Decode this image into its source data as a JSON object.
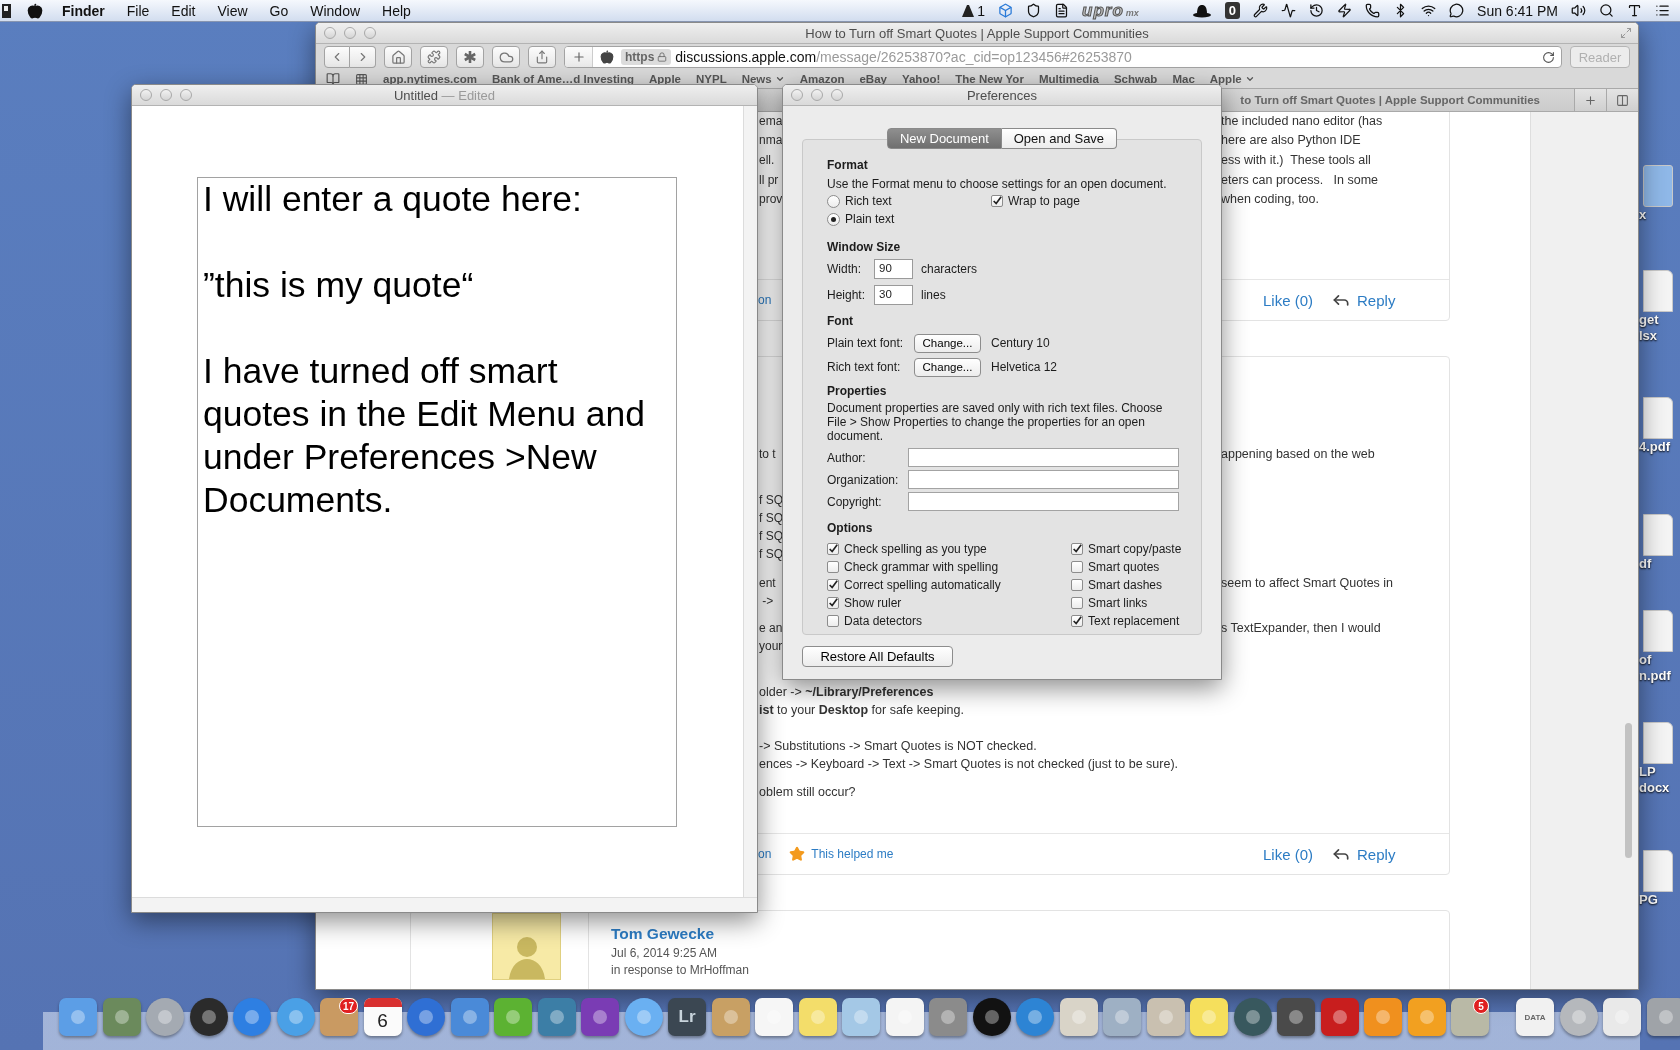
{
  "menu_bar": {
    "app_name": "Finder",
    "menus": [
      "File",
      "Edit",
      "View",
      "Go",
      "Window",
      "Help"
    ],
    "status": {
      "count": "1",
      "logo": "upro",
      "logo_suffix": "mx",
      "box_digit": "0",
      "clock": "Sun 6:41 PM"
    }
  },
  "browser": {
    "title": "How to Turn off Smart Quotes | Apple Support Communities",
    "address": {
      "scheme": "https",
      "host": "discussions.apple.com",
      "path": "/message/26253870?ac_cid=op123456#26253870"
    },
    "reader_button": {
      "label": "Reader",
      "disabled": true
    },
    "bookmarks": [
      {
        "label": "app.nytimes.com",
        "menu": false
      },
      {
        "label": "Bank of Ame…d Investing",
        "menu": false
      },
      {
        "label": "Apple",
        "menu": false
      },
      {
        "label": "NYPL",
        "menu": false
      },
      {
        "label": "News",
        "menu": true
      },
      {
        "label": "Amazon",
        "menu": false
      },
      {
        "label": "eBay",
        "menu": false
      },
      {
        "label": "Yahoo!",
        "menu": false
      },
      {
        "label": "The New Yor",
        "menu": false
      },
      {
        "label": "Multimedia",
        "menu": false
      },
      {
        "label": "Schwab",
        "menu": false
      },
      {
        "label": "Mac",
        "menu": false
      },
      {
        "label": "Apple",
        "menu": true
      }
    ],
    "tab": {
      "label": "to Turn off Smart Quotes | Apple Support Communities"
    },
    "posts": [
      {
        "kind": "fragment",
        "paragraphs": [
          [
            {
              "left": "ema",
              "right": "the included nano editor (has"
            },
            {
              "left": "nma",
              "right": "here are also Python IDE"
            },
            {
              "left": "ell.",
              "right": "ess with it.)  These tools all"
            },
            {
              "left": "ll pr",
              "right": "eters can process.   In some"
            },
            {
              "left": "prov",
              "right": "when coding, too."
            }
          ]
        ],
        "footer": {
          "link": "on",
          "like": "Like (0)",
          "reply": "Reply"
        }
      },
      {
        "kind": "fragment",
        "paragraphs": [
          [
            {
              "left": "to t",
              "right": "appening based on the web"
            }
          ],
          [
            {
              "left": "f SQ"
            },
            {
              "left": "f SQ"
            },
            {
              "left": "f SQ"
            },
            {
              "left": "f SQ"
            }
          ],
          [
            {
              "left": "ent",
              "right": "seem to affect Smart Quotes in"
            },
            {
              "left": " ->"
            }
          ],
          [
            {
              "left": "e an",
              "right": "s TextExpander, then I would"
            },
            {
              "left": "your"
            }
          ],
          [
            {
              "text": "older -> **~/Library/Preferences**"
            },
            {
              "text": "**ist** to your **Desktop** for safe keeping."
            }
          ],
          [
            {
              "text": "-> Substitutions -> Smart Quotes is NOT checked."
            },
            {
              "text": "ences -> Keyboard -> Text -> Smart Quotes is not checked (just to be sure)."
            }
          ],
          [
            {
              "text": "oblem still occur?"
            }
          ]
        ],
        "footer": {
          "link": "on",
          "helped": "This helped me",
          "like": "Like (0)",
          "reply": "Reply"
        }
      },
      {
        "kind": "author",
        "name": "Tom Gewecke",
        "date": "Jul 6, 2014 9:25 AM",
        "in_reply": "in response to MrHoffman"
      }
    ]
  },
  "textedit": {
    "title": "Untitled",
    "edited": "— Edited",
    "paragraphs": [
      "I will enter a quote here:",
      "”this is my quote“",
      "I have turned off smart quotes in the Edit Menu and under Preferences >New Documents."
    ]
  },
  "preferences": {
    "title": "Preferences",
    "tabs": [
      {
        "label": "New Document",
        "selected": true
      },
      {
        "label": "Open and Save",
        "selected": false
      }
    ],
    "format": {
      "heading": "Format",
      "description": "Use the Format menu to choose settings for an open document.",
      "radios": [
        {
          "label": "Rich text",
          "selected": false
        },
        {
          "label": "Plain text",
          "selected": true
        }
      ],
      "wrap": {
        "label": "Wrap to page",
        "checked": true
      }
    },
    "window_size": {
      "heading": "Window Size",
      "fields": [
        {
          "label": "Width:",
          "value": "90",
          "unit": "characters"
        },
        {
          "label": "Height:",
          "value": "30",
          "unit": "lines"
        }
      ]
    },
    "font": {
      "heading": "Font",
      "rows": [
        {
          "label": "Plain text font:",
          "button": "Change...",
          "value": "Century 10"
        },
        {
          "label": "Rich text font:",
          "button": "Change...",
          "value": "Helvetica 12"
        }
      ]
    },
    "properties": {
      "heading": "Properties",
      "description": "Document properties are saved only with rich text files. Choose File > Show Properties to change the properties for an open document.",
      "fields": [
        {
          "label": "Author:"
        },
        {
          "label": "Organization:"
        },
        {
          "label": "Copyright:"
        }
      ]
    },
    "options": {
      "heading": "Options",
      "left": [
        {
          "label": "Check spelling as you type",
          "checked": true
        },
        {
          "label": "Check grammar with spelling",
          "checked": false
        },
        {
          "label": "Correct spelling automatically",
          "checked": true
        },
        {
          "label": "Show ruler",
          "checked": true
        },
        {
          "label": "Data detectors",
          "checked": false
        }
      ],
      "right": [
        {
          "label": "Smart copy/paste",
          "checked": true
        },
        {
          "label": "Smart quotes",
          "checked": false
        },
        {
          "label": "Smart dashes",
          "checked": false
        },
        {
          "label": "Smart links",
          "checked": false
        },
        {
          "label": "Text replacement",
          "checked": true
        }
      ]
    },
    "restore_button": "Restore All Defaults"
  },
  "desktop_icons": [
    {
      "lines": [
        "x"
      ]
    },
    {
      "lines": [
        "get",
        "lsx"
      ]
    },
    {
      "lines": [
        "4.pdf"
      ]
    },
    {
      "lines": [
        "df"
      ]
    },
    {
      "lines": [
        "of",
        "n.pdf"
      ]
    },
    {
      "lines": [
        "LP",
        "docx"
      ]
    },
    {
      "lines": [
        "PG"
      ]
    }
  ],
  "dock": {
    "badges": [
      "17",
      "5"
    ],
    "calendar_day": "6",
    "icon_texts": [
      "Lr",
      "DATA"
    ]
  }
}
